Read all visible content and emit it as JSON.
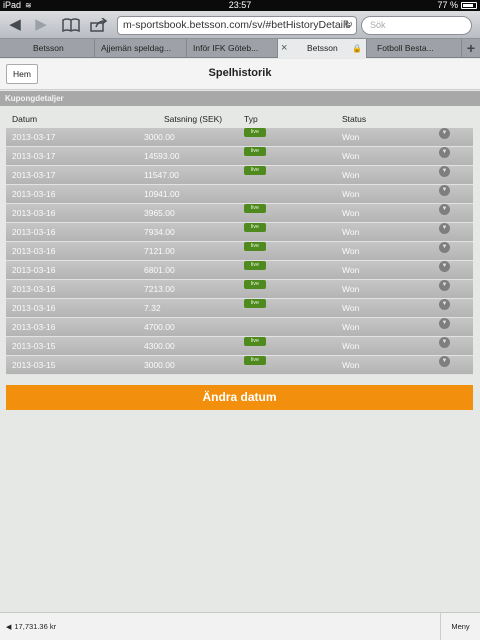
{
  "status_bar": {
    "device": "iPad",
    "wifi": "≋",
    "time": "23:57",
    "battery": "77 %"
  },
  "browser": {
    "url": "m-sportsbook.betsson.com/sv/#betHistoryDetails",
    "search_placeholder": "Sök",
    "tabs": [
      {
        "label": "Betsson"
      },
      {
        "label": "Ajjemän speldag..."
      },
      {
        "label": "Inför IFK Göteb..."
      },
      {
        "label": "Betsson"
      },
      {
        "label": "Fotboll Besta..."
      }
    ]
  },
  "header": {
    "back_label": "Hem",
    "title": "Spelhistorik"
  },
  "section": {
    "title": "Kupongdetaljer"
  },
  "table": {
    "columns": {
      "date": "Datum",
      "stake": "Satsning (SEK)",
      "type": "Typ",
      "status": "Status"
    },
    "badge_label": "live",
    "rows": [
      {
        "date": "2013-03-17",
        "stake": "3000.00",
        "live": true,
        "status": "Won"
      },
      {
        "date": "2013-03-17",
        "stake": "14593.00",
        "live": true,
        "status": "Won"
      },
      {
        "date": "2013-03-17",
        "stake": "11547.00",
        "live": true,
        "status": "Won"
      },
      {
        "date": "2013-03-16",
        "stake": "10941.00",
        "live": false,
        "status": "Won"
      },
      {
        "date": "2013-03-16",
        "stake": "3965.00",
        "live": true,
        "status": "Won"
      },
      {
        "date": "2013-03-16",
        "stake": "7934.00",
        "live": true,
        "status": "Won"
      },
      {
        "date": "2013-03-16",
        "stake": "7121.00",
        "live": true,
        "status": "Won"
      },
      {
        "date": "2013-03-16",
        "stake": "6801.00",
        "live": true,
        "status": "Won"
      },
      {
        "date": "2013-03-16",
        "stake": "7213.00",
        "live": true,
        "status": "Won"
      },
      {
        "date": "2013-03-16",
        "stake": "7.32",
        "live": true,
        "status": "Won"
      },
      {
        "date": "2013-03-16",
        "stake": "4700.00",
        "live": false,
        "status": "Won"
      },
      {
        "date": "2013-03-15",
        "stake": "4300.00",
        "live": true,
        "status": "Won"
      },
      {
        "date": "2013-03-15",
        "stake": "3000.00",
        "live": true,
        "status": "Won"
      }
    ]
  },
  "actions": {
    "change_date": "Ändra datum"
  },
  "footer": {
    "balance": "17,731.36 kr",
    "menu": "Meny"
  }
}
